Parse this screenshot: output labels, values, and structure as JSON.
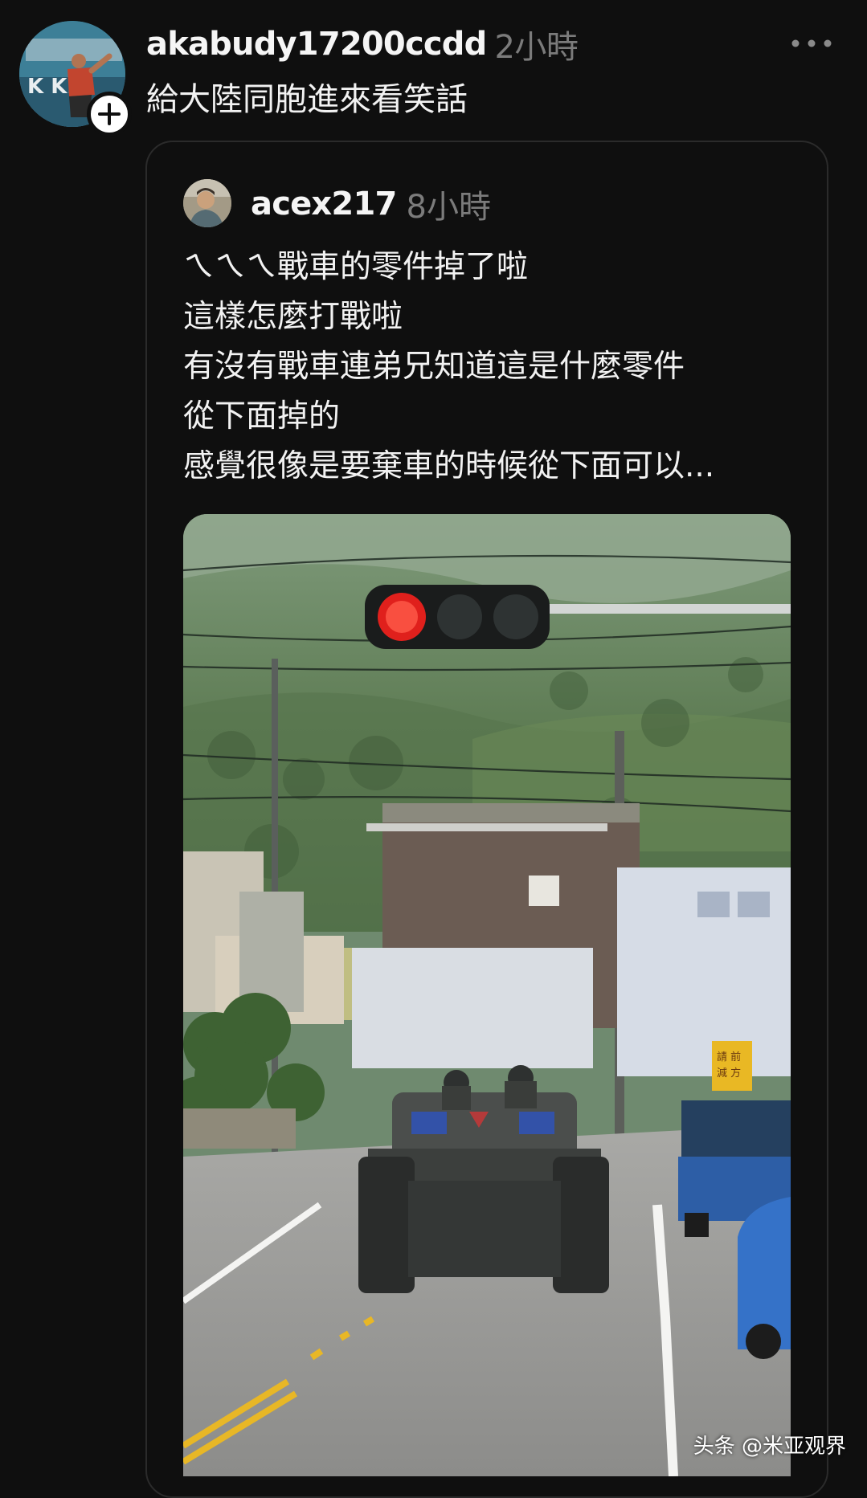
{
  "post": {
    "username": "akabudy17200ccdd",
    "timestamp": "2小時",
    "text": "給大陸同胞進來看笑話",
    "avatar_icon": "user-avatar",
    "follow_icon": "plus-icon",
    "more_icon": "more-horizontal-icon"
  },
  "quoted_post": {
    "username": "acex217",
    "timestamp": "8小時",
    "avatar_icon": "user-avatar",
    "lines": [
      "ㄟㄟㄟ戰車的零件掉了啦",
      "這樣怎麼打戰啦",
      "有沒有戰車連弟兄知道這是什麼零件",
      "從下面掉的",
      "感覺很像是要棄車的時候從下面可以..."
    ],
    "media": {
      "sign_text": "請減速前方"
    }
  },
  "watermark": "头条 @米亚观界",
  "colors": {
    "background": "#0f0f0f",
    "text": "#f2f2f2",
    "muted": "#7b7b7b",
    "card_border": "#2b2b2b",
    "traffic_red": "#e0201c"
  }
}
